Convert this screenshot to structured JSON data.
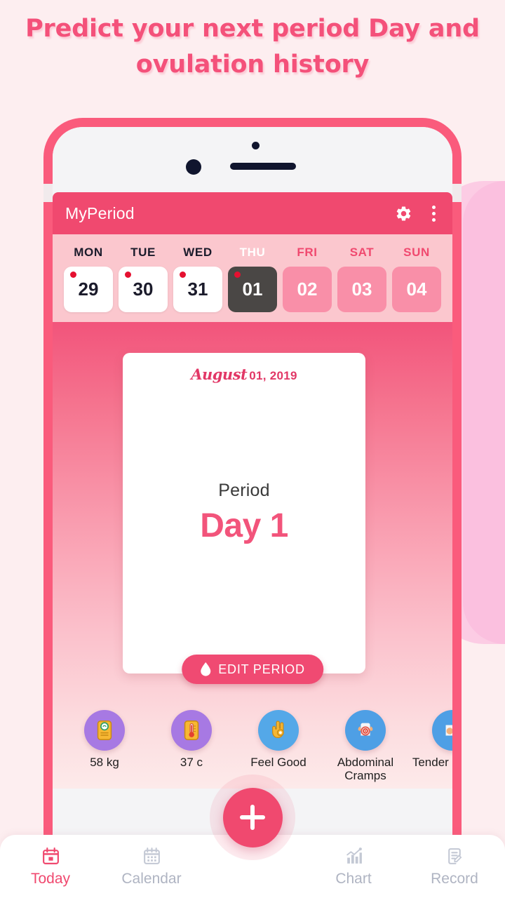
{
  "headline": "Predict your next period Day and ovulation history",
  "app": {
    "title": "MyPeriod",
    "settings_icon": "gear-icon",
    "overflow_icon": "kebab-menu-icon"
  },
  "week": {
    "days": [
      {
        "dow": "MON",
        "num": "29",
        "state": "past",
        "dot": true
      },
      {
        "dow": "TUE",
        "num": "30",
        "state": "past",
        "dot": true
      },
      {
        "dow": "WED",
        "num": "31",
        "state": "past",
        "dot": true
      },
      {
        "dow": "THU",
        "num": "01",
        "state": "today",
        "dot": true
      },
      {
        "dow": "FRI",
        "num": "02",
        "state": "future",
        "dot": false
      },
      {
        "dow": "SAT",
        "num": "03",
        "state": "future",
        "dot": false
      },
      {
        "dow": "SUN",
        "num": "04",
        "state": "future",
        "dot": false
      }
    ]
  },
  "card": {
    "date_script": "August",
    "date_plain": "01, 2019",
    "label": "Period",
    "day": "Day 1",
    "edit_button": "EDIT PERIOD",
    "edit_icon": "water-drop-icon"
  },
  "trackers": [
    {
      "label": "58 kg",
      "icon": "weight-scale-icon",
      "circle": "#A779E3"
    },
    {
      "label": "37 c",
      "icon": "thermometer-icon",
      "circle": "#A779E3"
    },
    {
      "label": "Feel Good",
      "icon": "ok-hand-icon",
      "circle": "#54A8E8"
    },
    {
      "label": "Abdominal Cramps",
      "icon": "abdominal-pain-icon",
      "circle": "#4E9FE5"
    },
    {
      "label": "Tender Breasts",
      "icon": "tender-breasts-icon",
      "circle": "#4E9FE5"
    }
  ],
  "bottom_nav": [
    {
      "label": "Today",
      "icon": "calendar-today-icon",
      "active": true
    },
    {
      "label": "Calendar",
      "icon": "calendar-icon",
      "active": false
    },
    {
      "label": "Chart",
      "icon": "bar-chart-icon",
      "active": false
    },
    {
      "label": "Record",
      "icon": "note-edit-icon",
      "active": false
    }
  ],
  "fab": {
    "icon": "plus-icon"
  },
  "colors": {
    "brand_pink": "#F0496F",
    "headline_pink": "#F4517A",
    "bezel_pink": "#FA5B7C",
    "today_dark": "#4A4745",
    "dot_red": "#E51030",
    "page_bg": "#FDEEF0"
  }
}
